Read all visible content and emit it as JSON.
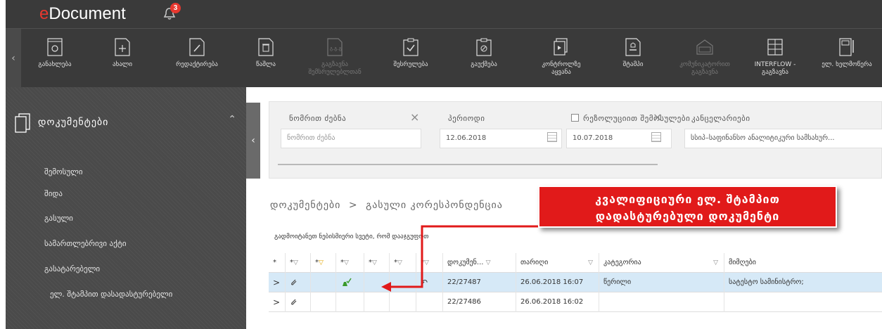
{
  "app": {
    "title_prefix": "e",
    "title_rest": "Document",
    "notification_count": "3"
  },
  "toolbar": {
    "items": [
      {
        "label": "განახლება",
        "icon": "refresh-doc-icon",
        "disabled": false
      },
      {
        "label": "ახალი",
        "icon": "new-doc-icon",
        "disabled": false
      },
      {
        "label": "რედაქტირება",
        "icon": "edit-doc-icon",
        "disabled": false
      },
      {
        "label": "წაშლა",
        "icon": "delete-doc-icon",
        "disabled": false
      },
      {
        "label": "გაგზავნა შემსრულებლთან",
        "icon": "send-to-executor-icon",
        "disabled": true
      },
      {
        "label": "შესრულება",
        "icon": "complete-doc-icon",
        "disabled": false
      },
      {
        "label": "გაუქმება",
        "icon": "cancel-doc-icon",
        "disabled": false
      },
      {
        "label": "კონტროლზე აყვანა",
        "icon": "control-icon",
        "disabled": false
      },
      {
        "label": "შტამპი",
        "icon": "stamp-icon",
        "disabled": false
      },
      {
        "label": "კომუნიკატორით გაგზავნა",
        "icon": "communicator-send-icon",
        "disabled": true
      },
      {
        "label": "INTERFLOW - გაგზავნა",
        "icon": "interflow-icon",
        "disabled": false
      },
      {
        "label": "ელ. ხელმოწერა",
        "icon": "e-signature-icon",
        "disabled": false
      }
    ]
  },
  "sidebar": {
    "section_title": "დოკუმენტები",
    "items": [
      {
        "label": "შემოსული"
      },
      {
        "label": "შიდა"
      },
      {
        "label": "გასული"
      },
      {
        "label": "სამართლებრივი აქტი"
      },
      {
        "label": "გასატარებელი"
      },
      {
        "label": "ელ. შტამპით დასადასტურებელი"
      }
    ]
  },
  "filters": {
    "number_search_label": "ნომრით ძებნა",
    "number_search_placeholder": "ნომრით ძებნა",
    "period_label": "პერიოდი",
    "date_from": "12.06.2018",
    "date_to": "10.07.2018",
    "registration_checkbox_label": "რეზოლუციით შემოსულები",
    "chancellery_label": "კანცელარიები",
    "chancellery_value": "სსიპ–საფინანსო ანალიტიკური სამსახურ..."
  },
  "breadcrumb": {
    "root": "დოკუმენტები",
    "separator": ">",
    "current": "გასული კორესპონდენცია"
  },
  "grid": {
    "group_hint": "გადმოიტანეთ ნებისმიერი სვეტი, რომ დააჯგუფოთ",
    "headers": [
      "*",
      "*",
      "*",
      "*",
      "*",
      "*",
      "*",
      "დოკუმენ...",
      "თარიღი",
      "კატეგორია",
      "მიმღები"
    ],
    "rows": [
      {
        "expand": ">",
        "doc": "22/27487",
        "date": "26.06.2018 16:07",
        "category": "წერილი",
        "recipient": "სატესტო სამინისტრო;"
      },
      {
        "expand": ">",
        "doc": "22/27486",
        "date": "26.06.2018 16:02",
        "category": "",
        "recipient": ""
      }
    ]
  },
  "callout": {
    "line1": "კვალიფიციური ელ. შტამპით",
    "line2": "დადასტურებული დოკუმენტი"
  },
  "colors": {
    "accent_red": "#e11a1a",
    "header_bg": "#3a3a3a",
    "row_highlight": "#d6e9f7",
    "stamp_green": "#3a9a2a"
  }
}
